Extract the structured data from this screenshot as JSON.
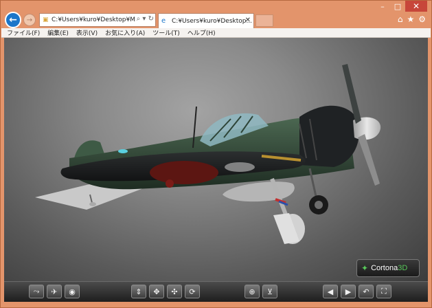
{
  "browser": {
    "address_text": "C:¥Users¥kuro¥Desktop¥My",
    "tab_title": "C:¥Users¥kuro¥Desktop...",
    "caption": {
      "minimize": "–",
      "maximize": "□",
      "close": "✕"
    },
    "right_icons": [
      "home-icon",
      "star-icon",
      "gear-icon"
    ]
  },
  "menu": {
    "items": [
      "ファイル(F)",
      "編集(E)",
      "表示(V)",
      "お気に入り(A)",
      "ツール(T)",
      "ヘルプ(H)"
    ]
  },
  "viewer": {
    "logo_text": "Cortona",
    "logo_suffix": "3D"
  },
  "toolbar": {
    "buttons": [
      "walk-icon",
      "fly-icon",
      "study-icon",
      "pan-icon",
      "plan-icon",
      "rotate-icon",
      "roll-icon",
      "fit-icon",
      "straighten-icon",
      "prev-viewpoint-icon",
      "next-viewpoint-icon",
      "restore-icon",
      "fullscreen-icon"
    ]
  },
  "colors": {
    "frame": "#e3946b",
    "accent": "#1c76c9",
    "close": "#c7463a"
  }
}
